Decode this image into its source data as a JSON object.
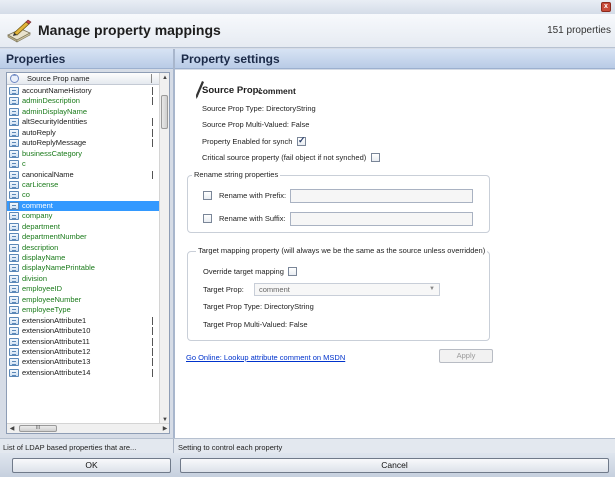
{
  "window": {
    "close_symbol": "x"
  },
  "header": {
    "title": "Manage property mappings",
    "count": "151 properties"
  },
  "left_panel": {
    "title": "Properties",
    "column_header": "Source Prop name",
    "scroll_thumb_label": "III",
    "items": [
      {
        "name": "accountNameHistory",
        "color": "black",
        "flag": true
      },
      {
        "name": "adminDescription",
        "color": "green",
        "flag": true
      },
      {
        "name": "adminDisplayName",
        "color": "green",
        "flag": false
      },
      {
        "name": "altSecurityIdentities",
        "color": "black",
        "flag": true
      },
      {
        "name": "autoReply",
        "color": "black",
        "flag": true
      },
      {
        "name": "autoReplyMessage",
        "color": "black",
        "flag": true
      },
      {
        "name": "businessCategory",
        "color": "green",
        "flag": false
      },
      {
        "name": "c",
        "color": "green",
        "flag": false
      },
      {
        "name": "canonicalName",
        "color": "black",
        "flag": true
      },
      {
        "name": "carLicense",
        "color": "green",
        "flag": false
      },
      {
        "name": "co",
        "color": "green",
        "flag": false
      },
      {
        "name": "comment",
        "color": "selected",
        "flag": false
      },
      {
        "name": "company",
        "color": "green",
        "flag": false
      },
      {
        "name": "department",
        "color": "green",
        "flag": false
      },
      {
        "name": "departmentNumber",
        "color": "green",
        "flag": false
      },
      {
        "name": "description",
        "color": "green",
        "flag": false
      },
      {
        "name": "displayName",
        "color": "green",
        "flag": false
      },
      {
        "name": "displayNamePrintable",
        "color": "green",
        "flag": false
      },
      {
        "name": "division",
        "color": "green",
        "flag": false
      },
      {
        "name": "employeeID",
        "color": "green",
        "flag": false
      },
      {
        "name": "employeeNumber",
        "color": "green",
        "flag": false
      },
      {
        "name": "employeeType",
        "color": "green",
        "flag": false
      },
      {
        "name": "extensionAttribute1",
        "color": "black",
        "flag": true
      },
      {
        "name": "extensionAttribute10",
        "color": "black",
        "flag": true
      },
      {
        "name": "extensionAttribute11",
        "color": "black",
        "flag": true
      },
      {
        "name": "extensionAttribute12",
        "color": "black",
        "flag": true
      },
      {
        "name": "extensionAttribute13",
        "color": "black",
        "flag": true
      },
      {
        "name": "extensionAttribute14",
        "color": "black",
        "flag": true
      }
    ]
  },
  "right_panel": {
    "title": "Property settings",
    "source_prop_label": "Source Prop:",
    "source_prop_value": "comment",
    "type_text": "Source Prop Type:   DirectoryString",
    "multivalued_text": "Source Prop Multi-Valued: False",
    "enabled_label": "Property Enabled for synch",
    "enabled_checked": true,
    "critical_label": "Critical source property (fail object if not synched)",
    "critical_checked": false,
    "rename": {
      "group_title": "Rename string properties",
      "prefix_label": "Rename with Prefix:",
      "suffix_label": "Rename with Suffix:",
      "prefix_value": "",
      "suffix_value": ""
    },
    "target": {
      "group_title": "Target mapping property (will always we be the same as the source unless overridden)",
      "override_label": "Override target mapping",
      "override_checked": false,
      "target_prop_label": "Target Prop:",
      "target_prop_value": "comment",
      "target_type_text": "Target Prop Type:    DirectoryString",
      "target_multivalued_text": "Target Prop Multi-Valued: False"
    },
    "link_text": "Go Online: Lookup attribute comment on MSDN",
    "apply_label": "Apply"
  },
  "status": {
    "left": "List of LDAP based properties that are...",
    "right": "Setting to control each property"
  },
  "footer": {
    "ok_label": "OK",
    "cancel_label": "Cancel"
  },
  "colors": {
    "green_text": "#197a19",
    "selection": "#3399ff",
    "link": "#0033cc"
  }
}
